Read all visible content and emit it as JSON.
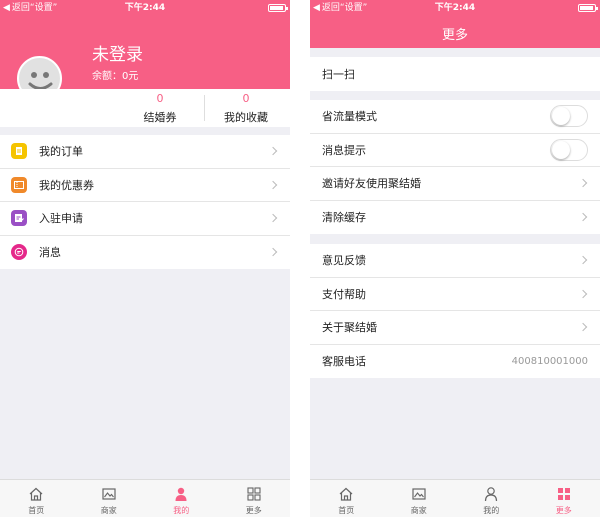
{
  "colors": {
    "brand": "#f75f85",
    "background": "#efeff4",
    "chevron": "#bbbbbb"
  },
  "status_bar": {
    "back_text": "返回“设置”",
    "time": "下午2:44"
  },
  "profile": {
    "name": "未登录",
    "balance": "余额：0元",
    "stats": [
      {
        "count": "0",
        "label": "结婚券"
      },
      {
        "count": "0",
        "label": "我的收藏"
      }
    ]
  },
  "menu": [
    {
      "label": "我的订单",
      "icon": "order-icon",
      "color": "#f5c400"
    },
    {
      "label": "我的优惠券",
      "icon": "coupon-icon",
      "color": "#f0892a"
    },
    {
      "label": "入驻申请",
      "icon": "application-icon",
      "color": "#9a4fc5"
    },
    {
      "label": "消息",
      "icon": "message-icon",
      "color": "#e5288a"
    }
  ],
  "settings": {
    "title": "更多",
    "groups": [
      [
        {
          "label": "扫一扫"
        }
      ],
      [
        {
          "label": "省流量模式",
          "toggle": false
        },
        {
          "label": "消息提示",
          "toggle": false
        },
        {
          "label": "邀请好友使用聚结婚"
        },
        {
          "label": "清除缓存"
        }
      ],
      [
        {
          "label": "意见反馈"
        },
        {
          "label": "支付帮助"
        },
        {
          "label": "关于聚结婚"
        },
        {
          "label": "客服电话",
          "value": "400810001000"
        }
      ]
    ]
  },
  "tabs": [
    {
      "label": "首页",
      "icon": "home-icon"
    },
    {
      "label": "商家",
      "icon": "merchant-icon"
    },
    {
      "label": "我的",
      "icon": "profile-icon"
    },
    {
      "label": "更多",
      "icon": "more-grid-icon"
    }
  ],
  "active_tab": {
    "left_screen": "我的",
    "right_screen": "更多"
  }
}
